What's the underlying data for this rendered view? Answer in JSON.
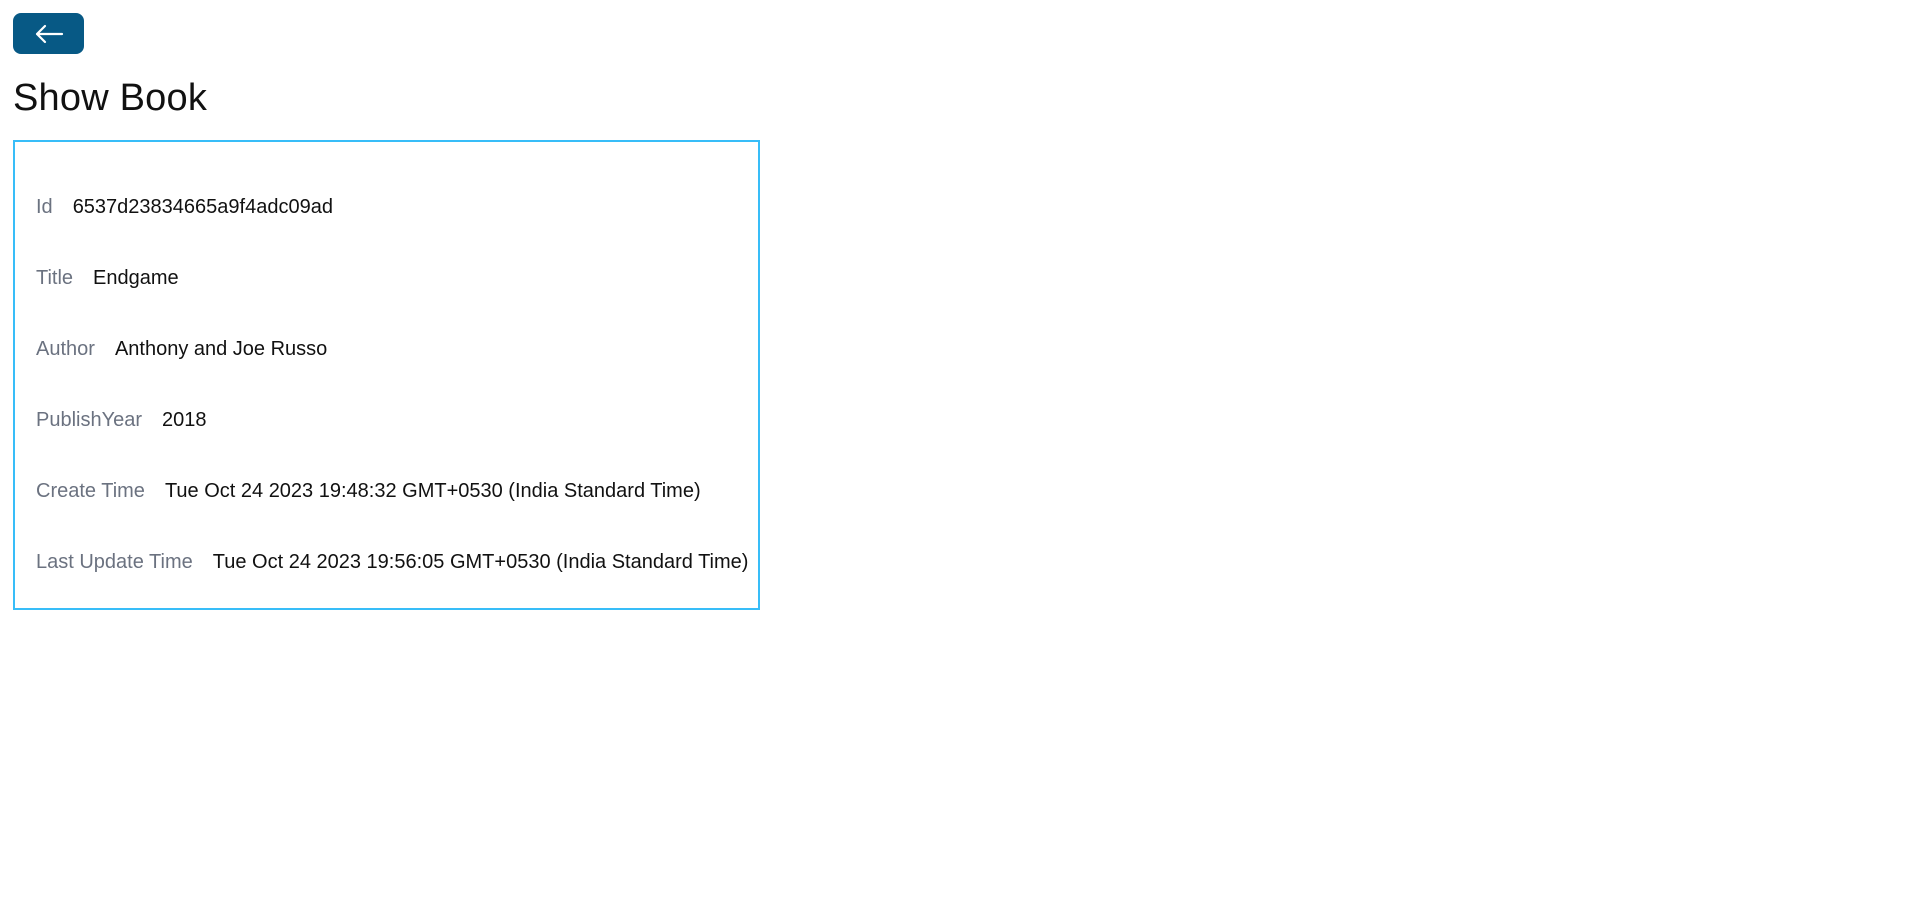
{
  "header": {
    "back_icon": "arrow-left-icon",
    "back_color": "#075985",
    "title": "Show Book"
  },
  "card": {
    "border_color": "#38bdf8",
    "fields": [
      {
        "label": "Id",
        "value": "6537d23834665a9f4adc09ad"
      },
      {
        "label": "Title",
        "value": "Endgame"
      },
      {
        "label": "Author",
        "value": "Anthony and Joe Russo"
      },
      {
        "label": "PublishYear",
        "value": "2018"
      },
      {
        "label": "Create Time",
        "value": "Tue Oct 24 2023 19:48:32 GMT+0530 (India Standard Time)"
      },
      {
        "label": "Last Update Time",
        "value": "Tue Oct 24 2023 19:56:05 GMT+0530 (India Standard Time)"
      }
    ]
  }
}
